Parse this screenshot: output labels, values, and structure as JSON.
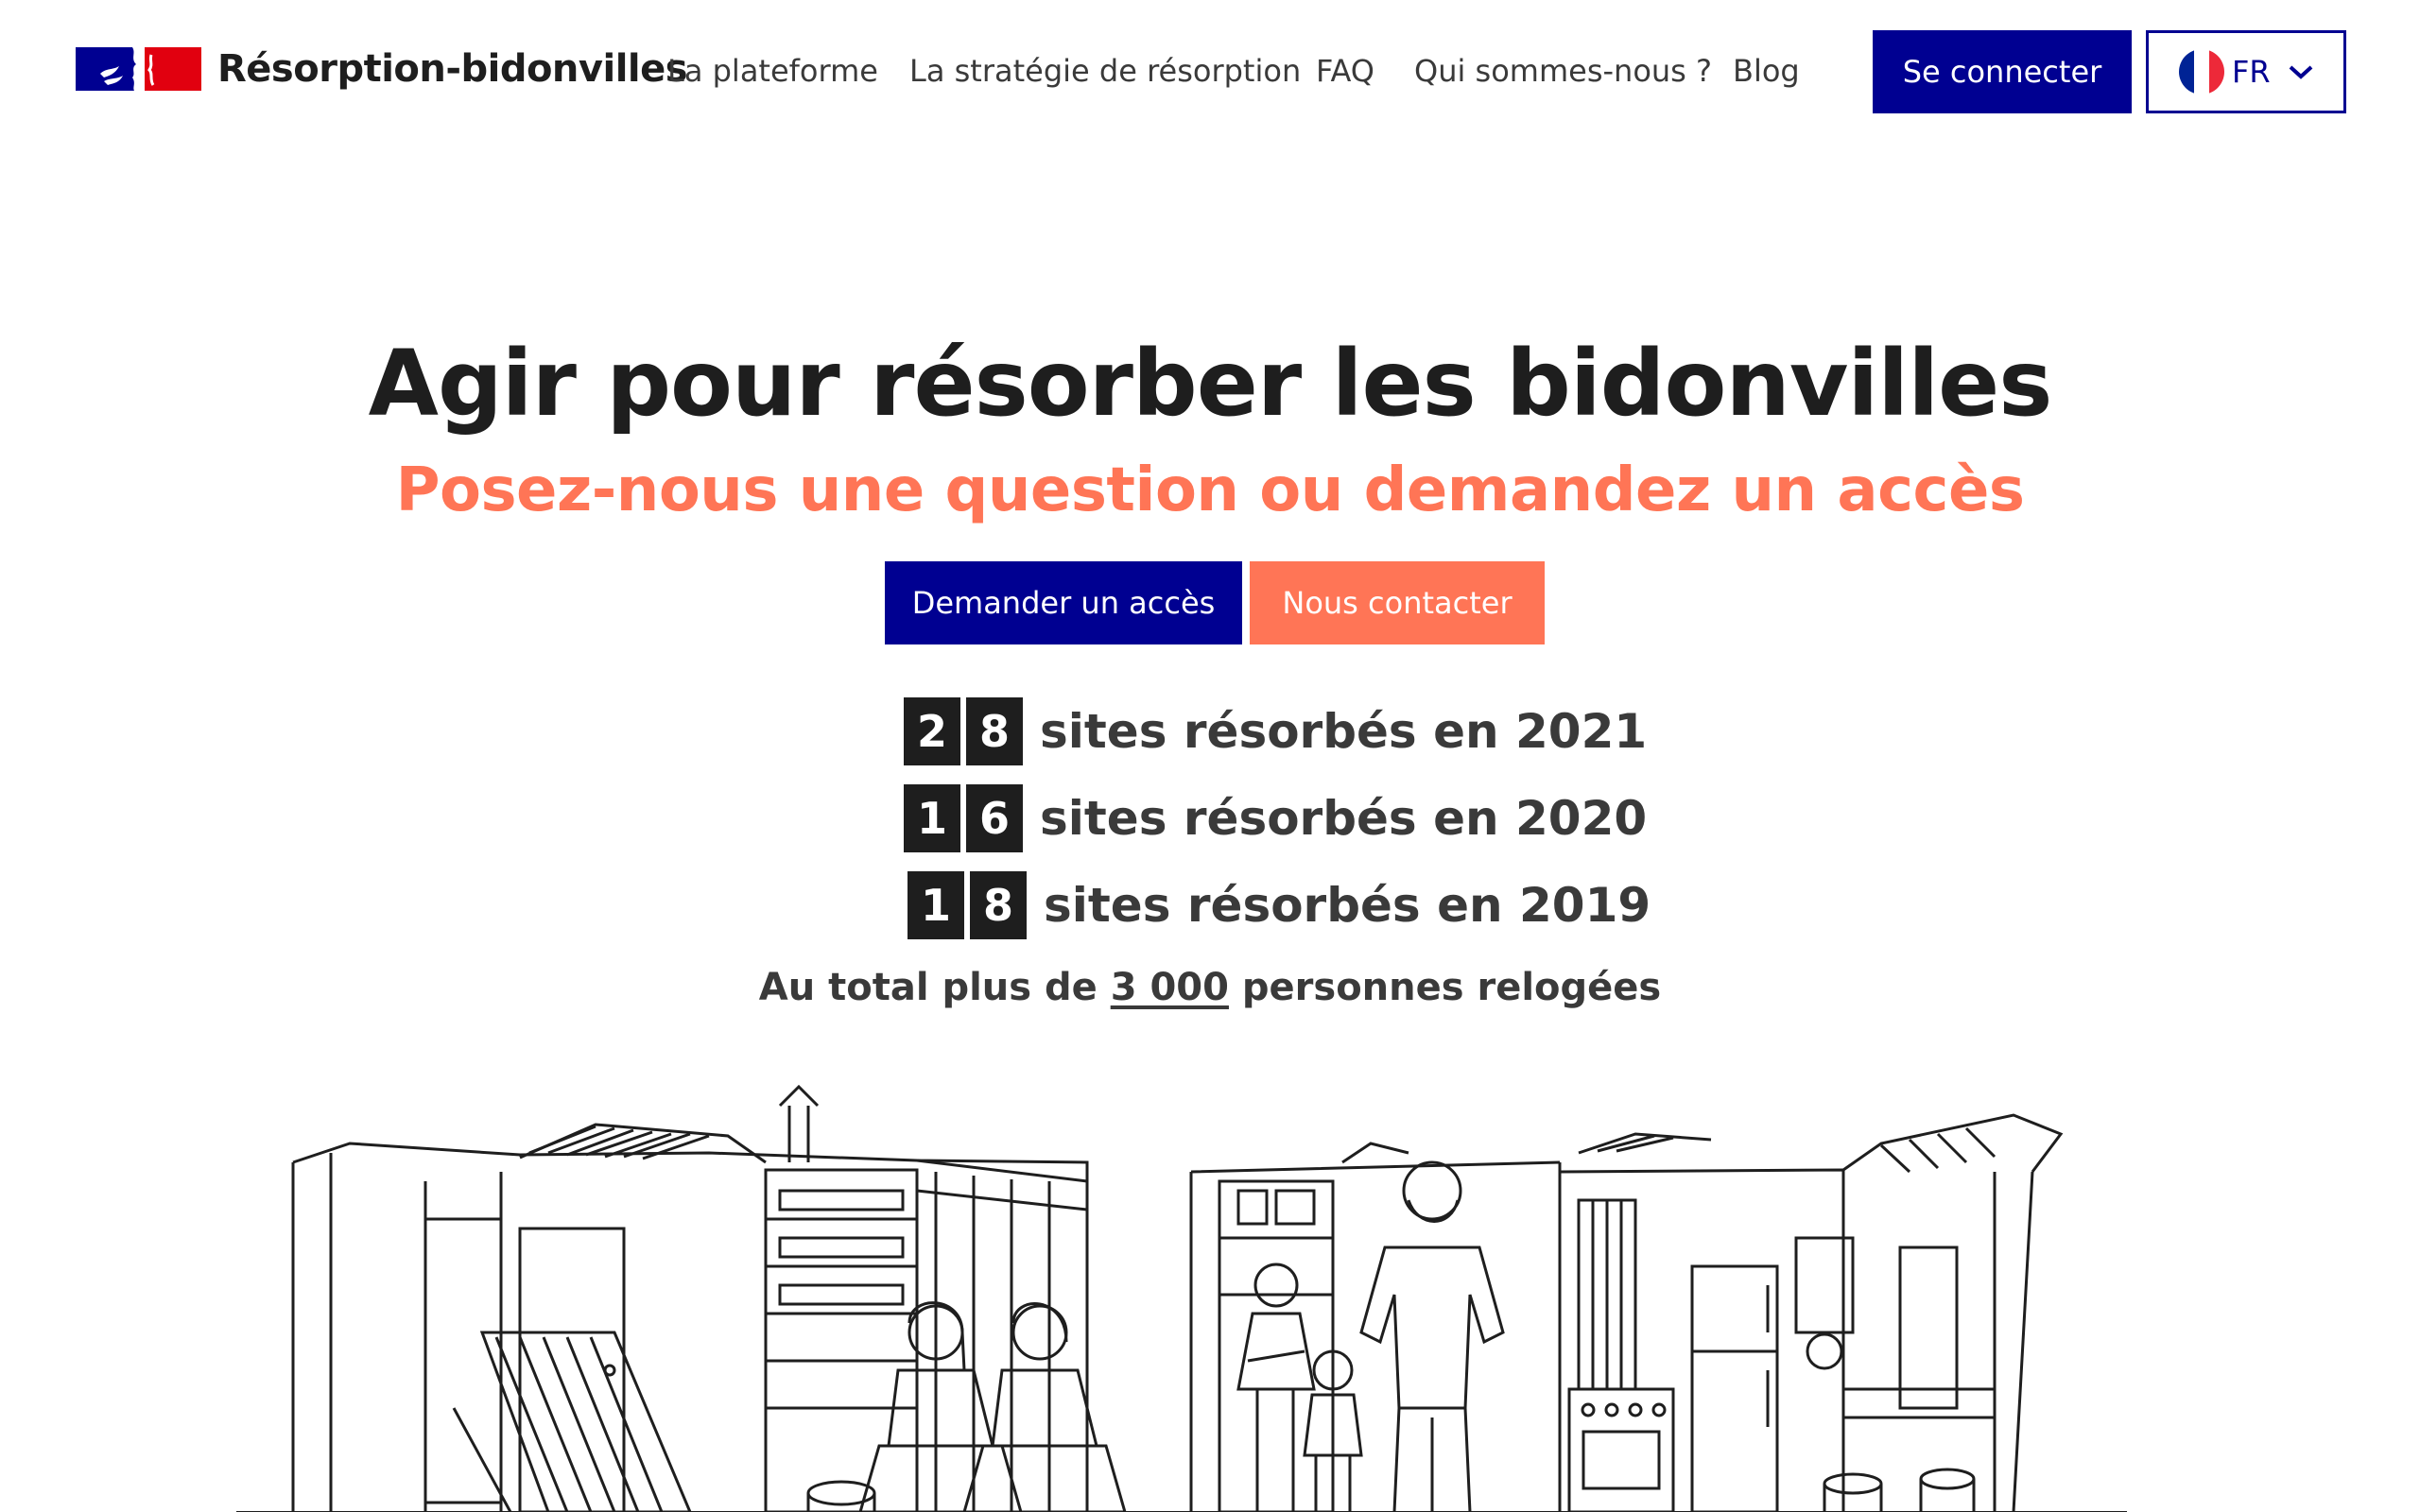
{
  "header": {
    "brand": "Résorption-bidonvilles",
    "nav": [
      "La plateforme",
      "La stratégie de résorption",
      "FAQ",
      "Qui sommes-nous ?",
      "Blog"
    ],
    "login_label": "Se connecter",
    "lang_label": "FR"
  },
  "hero": {
    "title": "Agir pour résorber les bidonvilles",
    "subtitle": "Posez-nous une question ou demandez un accès",
    "cta_primary": "Demander un accès",
    "cta_secondary": "Nous contacter"
  },
  "stats": [
    {
      "d1": "2",
      "d2": "8",
      "text": "sites résorbés en 2021"
    },
    {
      "d1": "1",
      "d2": "6",
      "text": "sites résorbés en 2020"
    },
    {
      "d1": "1",
      "d2": "8",
      "text": "sites résorbés en 2019"
    }
  ],
  "total": {
    "before": "Au total plus de ",
    "number": "3 000",
    "after": " personnes relogées"
  },
  "colors": {
    "primary": "#000091",
    "accent": "#ff7556",
    "text": "#1e1e1e",
    "marianne_red": "#e1000f"
  },
  "icons": {
    "logo": "marianne-logo-icon",
    "flag": "france-flag-icon",
    "chevron": "chevron-down-icon"
  }
}
